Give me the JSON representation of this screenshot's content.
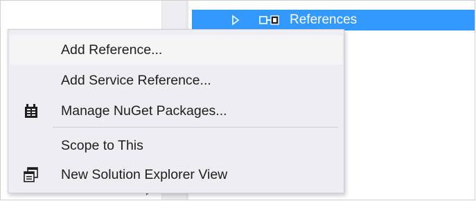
{
  "tree": {
    "selected_label": "References",
    "partial_label": "s"
  },
  "menu": {
    "items": [
      {
        "label": "Add Reference...",
        "icon": null
      },
      {
        "label": "Add Service Reference...",
        "icon": null
      },
      {
        "label": "Manage NuGet Packages...",
        "icon": "nuget-package-icon"
      },
      {
        "label": "Scope to This",
        "icon": null
      },
      {
        "label": "New Solution Explorer View",
        "icon": "new-window-icon"
      }
    ]
  },
  "colors": {
    "selection": "#3399ff",
    "menu_background": "#eeeef2",
    "menu_hover": "#f5f5f5",
    "text": "#1e1e1e"
  }
}
